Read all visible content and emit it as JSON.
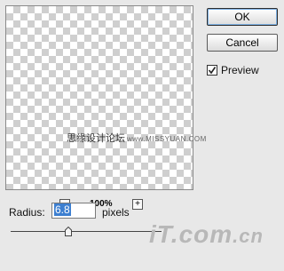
{
  "preview": {
    "watermark_cn": "思缘设计论坛",
    "watermark_site": "www.MISSYUAN.COM"
  },
  "buttons": {
    "ok": "OK",
    "cancel": "Cancel"
  },
  "preview_toggle": {
    "label": "Preview",
    "checked": true
  },
  "zoom": {
    "minus": "−",
    "plus": "+",
    "value": "100%"
  },
  "radius": {
    "label": "Radius:",
    "value": "6.8",
    "unit": "pixels",
    "slider_fraction": 0.38
  },
  "logo": {
    "text_main": "iT.com",
    "text_suffix": ".cn"
  }
}
